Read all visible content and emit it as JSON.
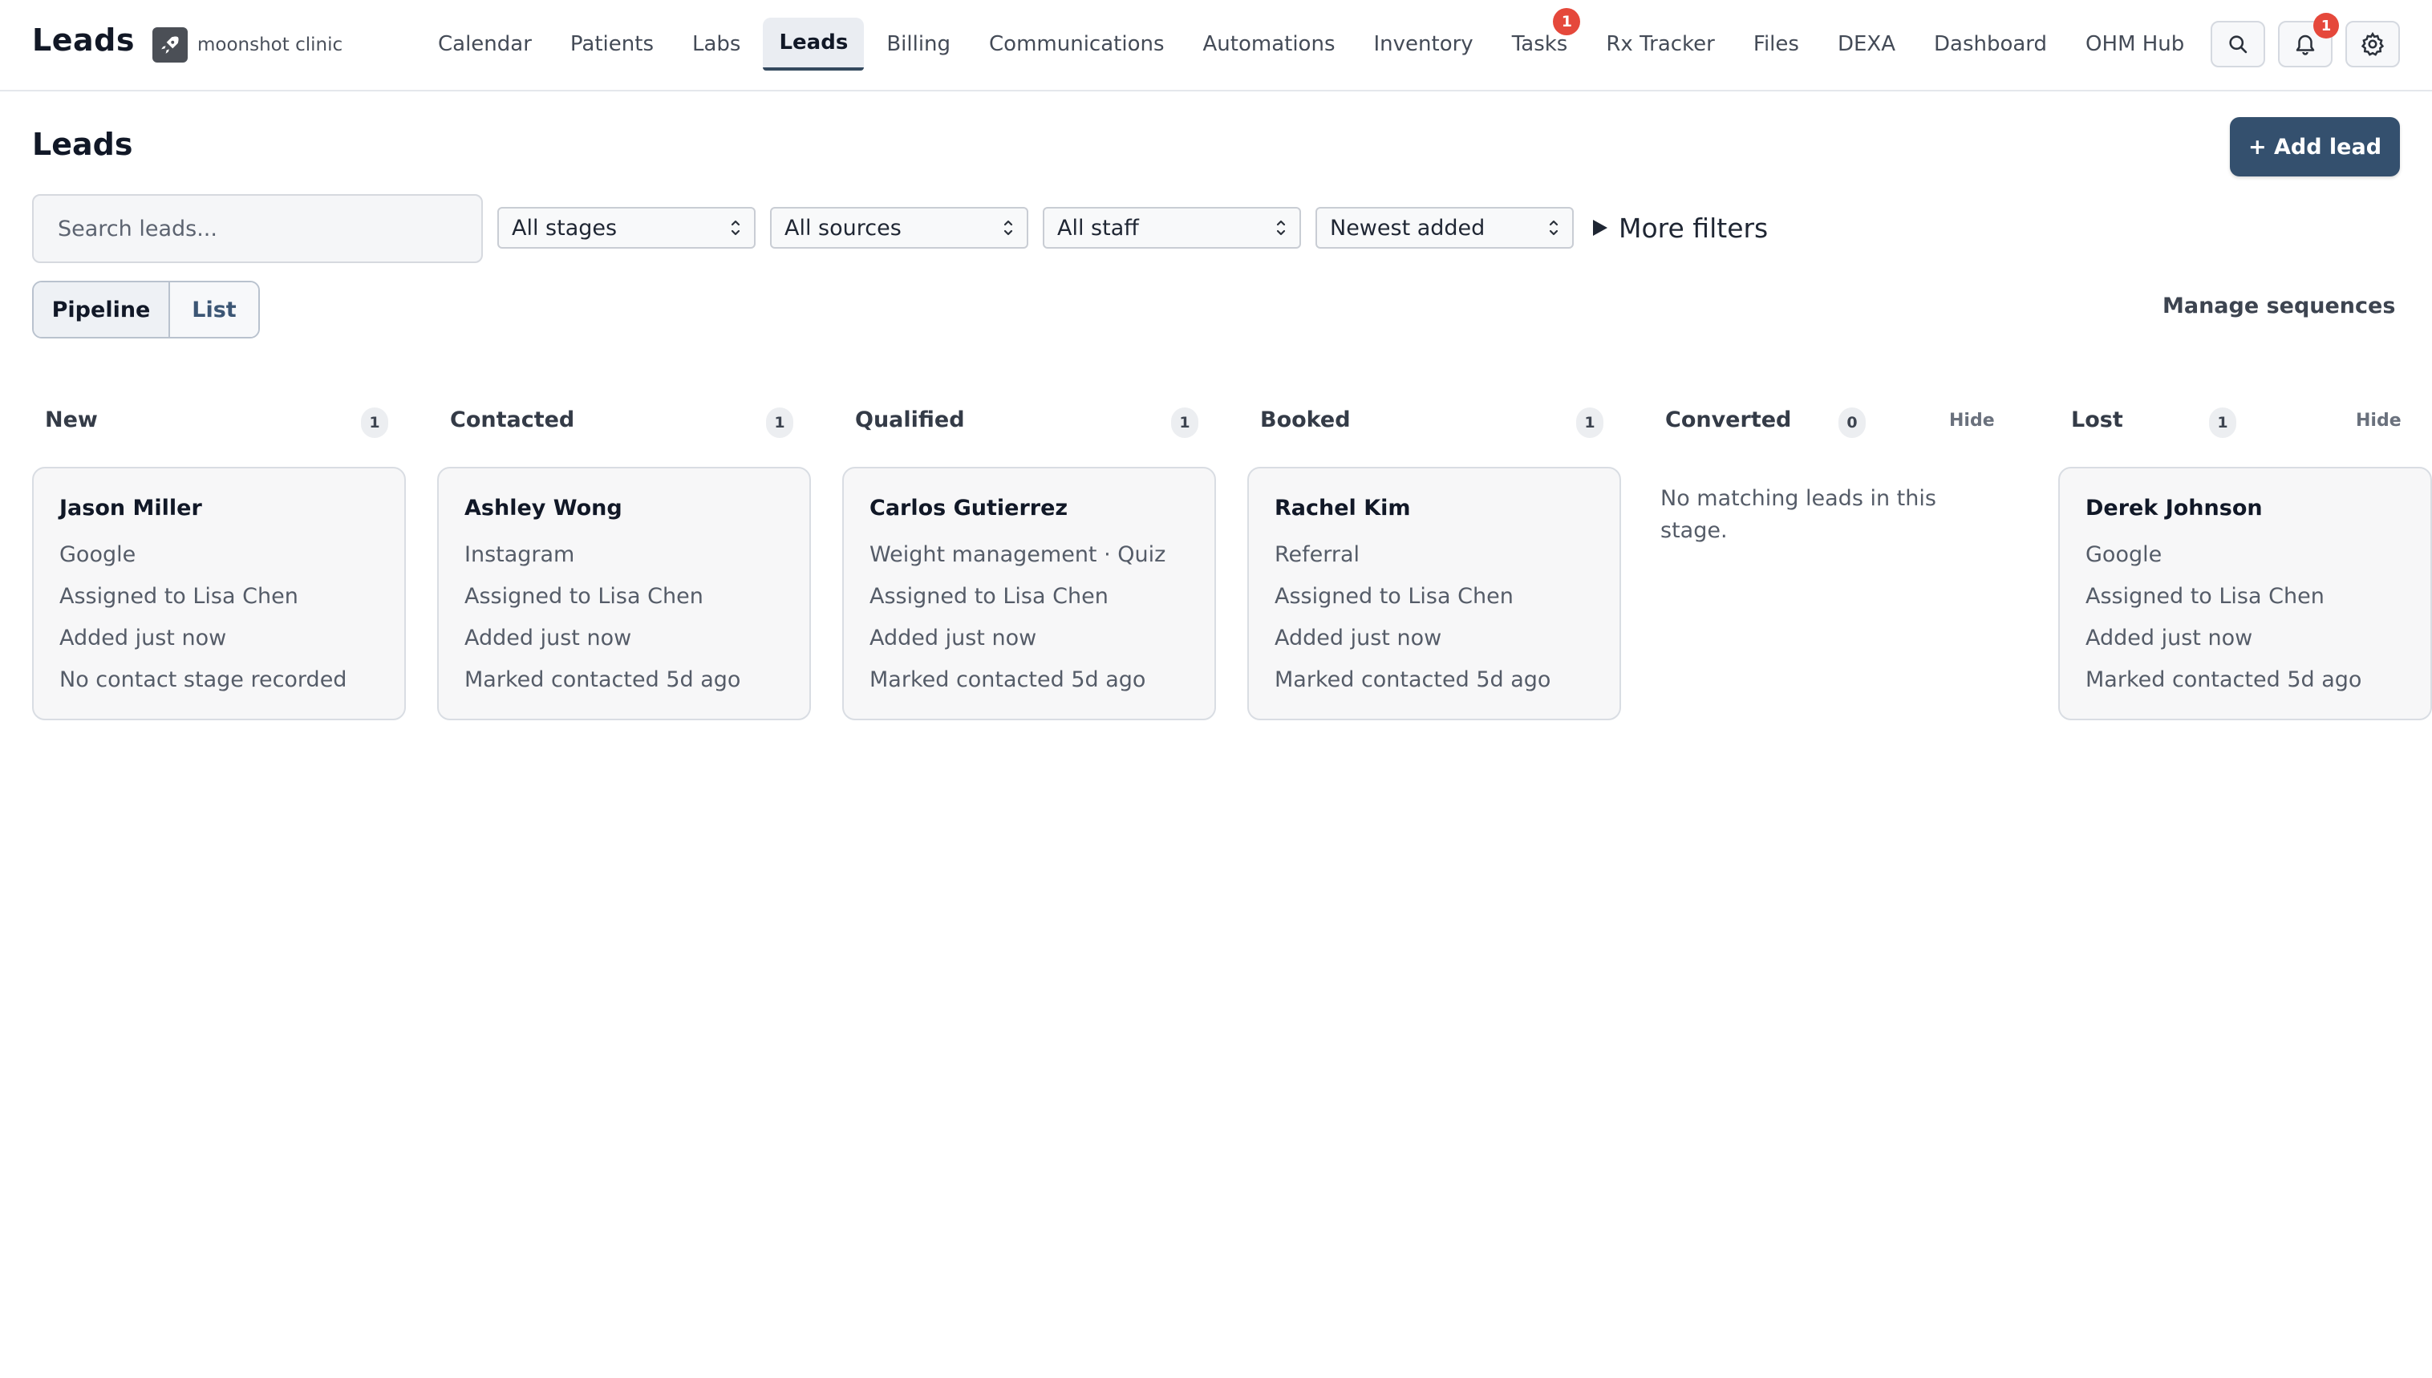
{
  "app": {
    "title": "Leads",
    "brand_name": "moonshot clinic"
  },
  "nav": {
    "items": [
      {
        "label": "Calendar"
      },
      {
        "label": "Patients"
      },
      {
        "label": "Labs"
      },
      {
        "label": "Leads",
        "active": true
      },
      {
        "label": "Billing"
      },
      {
        "label": "Communications"
      },
      {
        "label": "Automations"
      },
      {
        "label": "Inventory"
      },
      {
        "label": "Tasks",
        "badge": "1"
      },
      {
        "label": "Rx Tracker"
      },
      {
        "label": "Files"
      },
      {
        "label": "DEXA"
      },
      {
        "label": "Dashboard"
      },
      {
        "label": "OHM Hub"
      }
    ],
    "notifications_badge": "1",
    "icons": [
      "search-icon",
      "bell-icon",
      "gear-icon"
    ]
  },
  "page": {
    "title": "Leads",
    "add_lead_label": "+ Add lead"
  },
  "filters": {
    "search_placeholder": "Search leads...",
    "stage": "All stages",
    "source": "All sources",
    "staff": "All staff",
    "sort": "Newest added",
    "more_filters_label": "More filters"
  },
  "view": {
    "pipeline_label": "Pipeline",
    "list_label": "List",
    "manage_sequences_label": "Manage sequences"
  },
  "pipeline": {
    "hide_label": "Hide",
    "empty_text": "No matching leads in this stage.",
    "columns": [
      {
        "title": "New",
        "count": "1",
        "card": {
          "name": "Jason Miller",
          "source": "Google",
          "assigned": "Assigned to Lisa Chen",
          "added": "Added just now",
          "contact": "No contact stage recorded"
        }
      },
      {
        "title": "Contacted",
        "count": "1",
        "card": {
          "name": "Ashley Wong",
          "source": "Instagram",
          "assigned": "Assigned to Lisa Chen",
          "added": "Added just now",
          "contact": "Marked contacted 5d ago"
        }
      },
      {
        "title": "Qualified",
        "count": "1",
        "card": {
          "name": "Carlos Gutierrez",
          "source": "Weight management · Quiz",
          "assigned": "Assigned to Lisa Chen",
          "added": "Added just now",
          "contact": "Marked contacted 5d ago"
        }
      },
      {
        "title": "Booked",
        "count": "1",
        "card": {
          "name": "Rachel Kim",
          "source": "Referral",
          "assigned": "Assigned to Lisa Chen",
          "added": "Added just now",
          "contact": "Marked contacted 5d ago"
        }
      },
      {
        "title": "Converted",
        "count": "0"
      },
      {
        "title": "Lost",
        "count": "1",
        "card": {
          "name": "Derek Johnson",
          "source": "Google",
          "assigned": "Assigned to Lisa Chen",
          "added": "Added just now",
          "contact": "Marked contacted 5d ago"
        }
      }
    ]
  },
  "colors": {
    "primary_button": "#34506e",
    "badge": "#e5483b",
    "card_background": "#f7f7f8",
    "active_nav_underline": "#34495e"
  }
}
